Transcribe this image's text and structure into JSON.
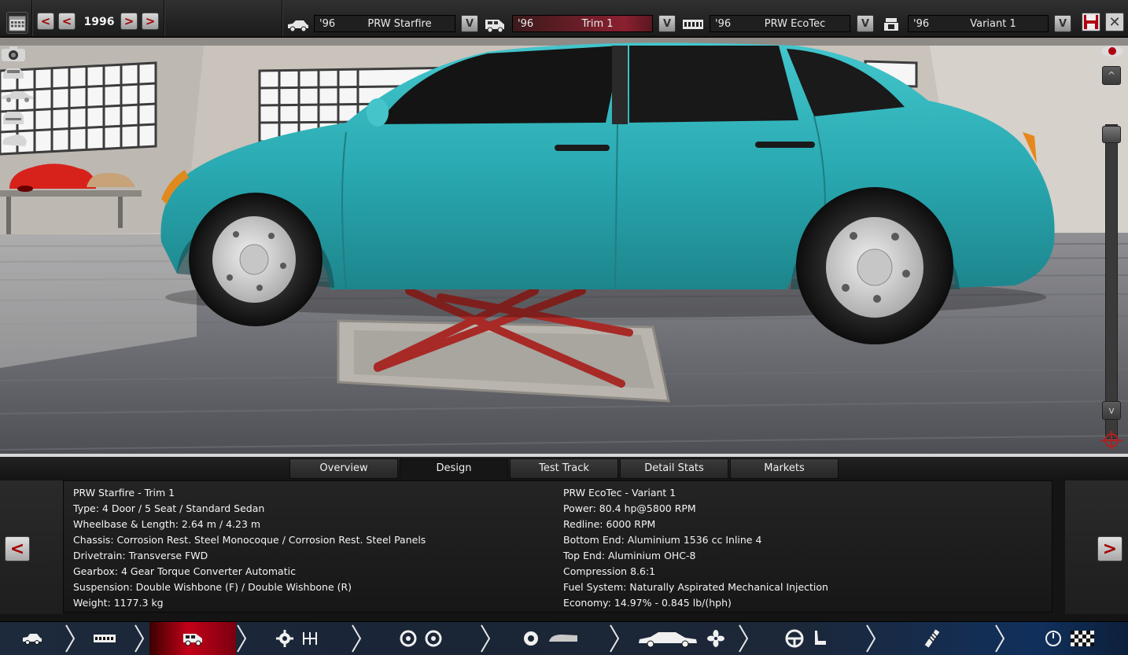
{
  "top_bar": {
    "year": "1996",
    "prev_decade": "<",
    "prev_year": "<",
    "next_year": ">",
    "next_decade": ">",
    "model": {
      "year": "'96",
      "name": "PRW Starfire",
      "dropdown": "V"
    },
    "trim": {
      "year": "'96",
      "name": "Trim 1",
      "dropdown": "V"
    },
    "engine": {
      "year": "'96",
      "name": "PRW EcoTec",
      "dropdown": "V"
    },
    "variant": {
      "year": "'96",
      "name": "Variant 1",
      "dropdown": "V"
    },
    "close_label": "✕"
  },
  "viewport": {
    "car_color": "#2fb1b8",
    "scroll_up": "^",
    "scroll_down": "v",
    "icons": [
      "camera-icon",
      "visibility-icon",
      "view-front-icon",
      "view-side-icon",
      "view-rear-icon",
      "view-top-icon",
      "reset-view-icon"
    ]
  },
  "tabs": [
    {
      "label": "Overview",
      "active": false
    },
    {
      "label": "Design",
      "active": true
    },
    {
      "label": "Test Track",
      "active": false
    },
    {
      "label": "Detail Stats",
      "active": false
    },
    {
      "label": "Markets",
      "active": false
    }
  ],
  "summary": {
    "car": [
      "PRW Starfire - Trim 1",
      "Type: 4 Door / 5 Seat / Standard Sedan",
      "Wheelbase & Length: 2.64 m / 4.23 m",
      "Chassis: Corrosion Rest. Steel Monocoque / Corrosion Rest. Steel Panels",
      "Drivetrain: Transverse FWD",
      "Gearbox: 4 Gear Torque Converter Automatic",
      "Suspension: Double Wishbone (F) / Double Wishbone (R)",
      "Weight: 1177.3 kg"
    ],
    "engine": [
      "PRW EcoTec - Variant 1",
      "Power: 80.4 hp@5800 RPM",
      "Redline: 6000 RPM",
      "Bottom End: Aluminium 1536 cc Inline 4",
      "Top End: Aluminium OHC-8",
      "Compression 8.6:1",
      "Fuel System: Naturally Aspirated Mechanical Injection",
      "Economy: 14.97% - 0.845 lb/(hph)"
    ],
    "prev_label": "<",
    "next_label": ">"
  },
  "bottom_nav": {
    "steps": [
      {
        "name": "model",
        "icons": [
          "car-model-icon"
        ],
        "active": false
      },
      {
        "name": "chassis",
        "icons": [
          "chassis-icon"
        ],
        "active": false
      },
      {
        "name": "trim",
        "icons": [
          "car-trim-icon"
        ],
        "active": true
      },
      {
        "name": "drivetrain",
        "icons": [
          "engine-gear-icon",
          "gearbox-icon"
        ],
        "active": false
      },
      {
        "name": "wheels",
        "icons": [
          "tyre-icon",
          "tyre-icon"
        ],
        "active": false
      },
      {
        "name": "body",
        "icons": [
          "wheel-icon",
          "body-panel-icon"
        ],
        "active": false
      },
      {
        "name": "aero",
        "icons": [
          "car-body-icon",
          "fan-icon"
        ],
        "active": false
      },
      {
        "name": "interior",
        "icons": [
          "steering-wheel-icon",
          "seat-icon"
        ],
        "active": false
      },
      {
        "name": "suspension",
        "icons": [
          "shock-absorber-icon"
        ],
        "active": false
      },
      {
        "name": "testing",
        "icons": [
          "gauge-icon",
          "checkered-flag-icon"
        ],
        "active": false
      }
    ]
  },
  "colors": {
    "accent_red": "#c40018",
    "nav_blue": "#10305c",
    "car_teal": "#2fb1b8",
    "lift_red": "#a72a26"
  }
}
